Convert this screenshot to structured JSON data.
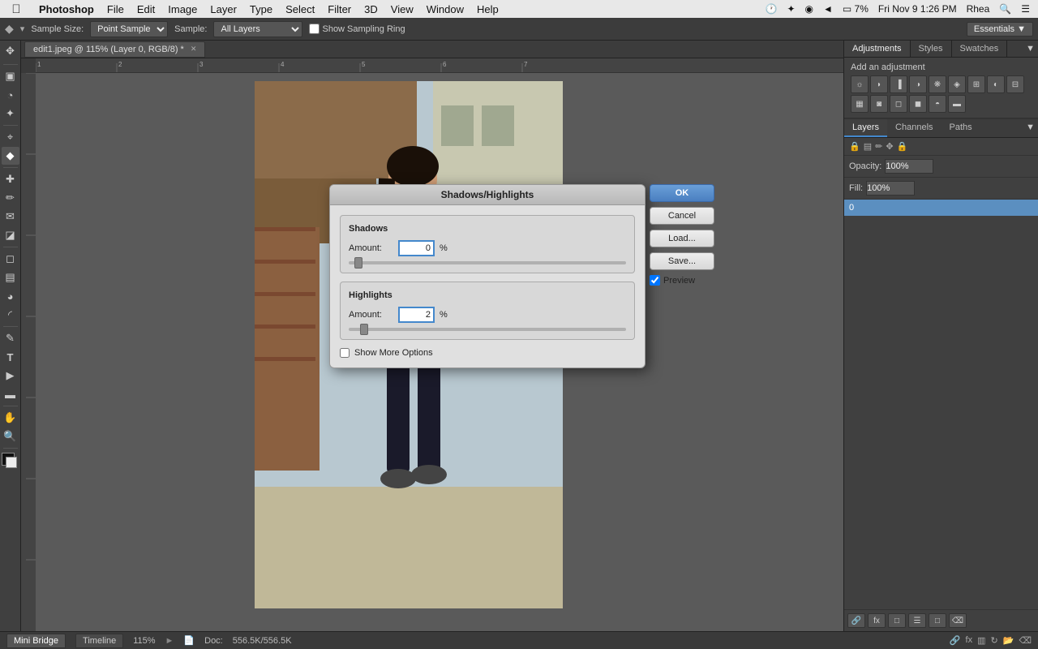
{
  "menubar": {
    "apple": "&#63743;",
    "items": [
      "Photoshop",
      "File",
      "Edit",
      "Image",
      "Layer",
      "Type",
      "Select",
      "Filter",
      "3D",
      "View",
      "Window",
      "Help"
    ],
    "right": {
      "time": "Fri Nov 9  1:26 PM",
      "user": "Rhea"
    }
  },
  "optionsbar": {
    "eyedropper_icon": "&#9670;",
    "sample_size_label": "Sample Size:",
    "sample_size_value": "Point Sample",
    "sample_label": "Sample:",
    "sample_value": "All Layers",
    "sampling_ring_label": "Show Sampling Ring",
    "essentials_label": "Essentials ▼"
  },
  "tab": {
    "title": "edit1.jpeg @ 115% (Layer 0, RGB/8) *",
    "close": "✕"
  },
  "dialog": {
    "title": "Shadows/Highlights",
    "shadows": {
      "group_label": "Shadows",
      "amount_label": "Amount:",
      "amount_value": "0",
      "amount_pct": "%",
      "slider_position": "3"
    },
    "highlights": {
      "group_label": "Highlights",
      "amount_label": "Amount:",
      "amount_value": "2",
      "amount_pct": "%",
      "slider_position": "5"
    },
    "show_more_label": "Show More Options",
    "buttons": {
      "ok": "OK",
      "cancel": "Cancel",
      "load": "Load...",
      "save": "Save..."
    },
    "preview_label": "Preview",
    "preview_checked": true
  },
  "right_panel": {
    "tabs": [
      "Adjustments",
      "Styles",
      "Swatches"
    ],
    "add_adjustment_label": "Add an adjustment",
    "adj_icons": [
      "brightness",
      "curves",
      "levels",
      "exposure",
      "vibrance",
      "hue",
      "color_balance",
      "photo_filter",
      "channel_mixer",
      "color_lookup",
      "invert",
      "posterize",
      "threshold",
      "selective_color",
      "gradient_map"
    ],
    "layers_tabs": [
      "Layers",
      "Channels",
      "Paths"
    ],
    "opacity_label": "Opacity:",
    "opacity_value": "100%",
    "fill_label": "Fill:",
    "fill_value": "100%",
    "lock_icon": "&#128274;",
    "layer_name": "0",
    "layers_footer_icons": [
      "&#128279;",
      "fx",
      "&#9633;",
      "&#9776;",
      "&#128065;",
      "&#9003;"
    ]
  },
  "statusbar": {
    "zoom": "115%",
    "doc_label": "Doc:",
    "doc_size": "556.5K/556.5K",
    "mini_bridge": "Mini Bridge",
    "timeline": "Timeline"
  },
  "toolbar": {
    "tools": [
      {
        "name": "move",
        "icon": "&#10021;"
      },
      {
        "name": "marquee",
        "icon": "&#9635;"
      },
      {
        "name": "lasso",
        "icon": "&#9950;"
      },
      {
        "name": "quick-select",
        "icon": "&#10022;"
      },
      {
        "name": "crop",
        "icon": "&#8982;"
      },
      {
        "name": "eyedropper",
        "icon": "&#9670;"
      },
      {
        "name": "healing",
        "icon": "&#10010;"
      },
      {
        "name": "brush",
        "icon": "&#9999;"
      },
      {
        "name": "clone",
        "icon": "&#9993;"
      },
      {
        "name": "history",
        "icon": "&#9706;"
      },
      {
        "name": "eraser",
        "icon": "&#9723;"
      },
      {
        "name": "gradient",
        "icon": "&#9636;"
      },
      {
        "name": "blur",
        "icon": "&#9685;"
      },
      {
        "name": "dodge",
        "icon": "&#9692;"
      },
      {
        "name": "pen",
        "icon": "&#9998;"
      },
      {
        "name": "type",
        "icon": "T"
      },
      {
        "name": "path-select",
        "icon": "&#9654;"
      },
      {
        "name": "shape",
        "icon": "&#9644;"
      },
      {
        "name": "hand",
        "icon": "&#9995;"
      },
      {
        "name": "zoom",
        "icon": "&#128269;"
      }
    ]
  }
}
